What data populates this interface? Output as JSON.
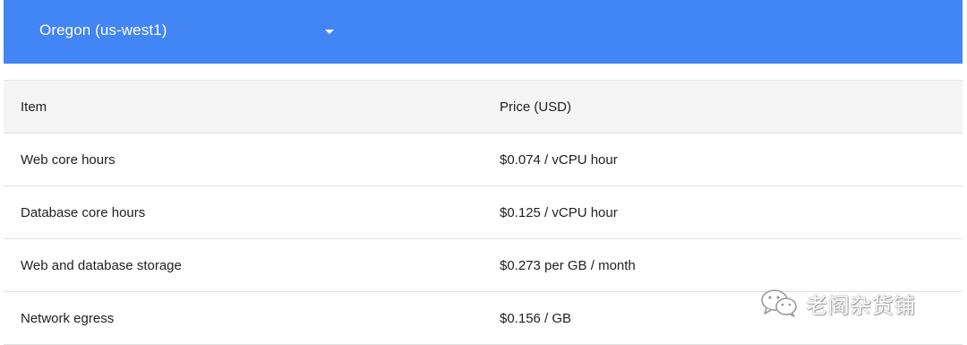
{
  "region_selector": {
    "selected": "Oregon (us-west1)",
    "background_color": "#4285f4",
    "caret_icon": "dropdown-caret-icon"
  },
  "pricing_table": {
    "headers": {
      "item": "Item",
      "price": "Price (USD)"
    },
    "rows": [
      {
        "item": "Web core hours",
        "price": "$0.074 / vCPU hour"
      },
      {
        "item": "Database core hours",
        "price": "$0.125 / vCPU hour"
      },
      {
        "item": "Web and database storage",
        "price": "$0.273 per GB / month"
      },
      {
        "item": "Network egress",
        "price": "$0.156 / GB"
      }
    ]
  },
  "watermark": {
    "icon": "wechat-icon",
    "text": "老阎杂货铺"
  }
}
